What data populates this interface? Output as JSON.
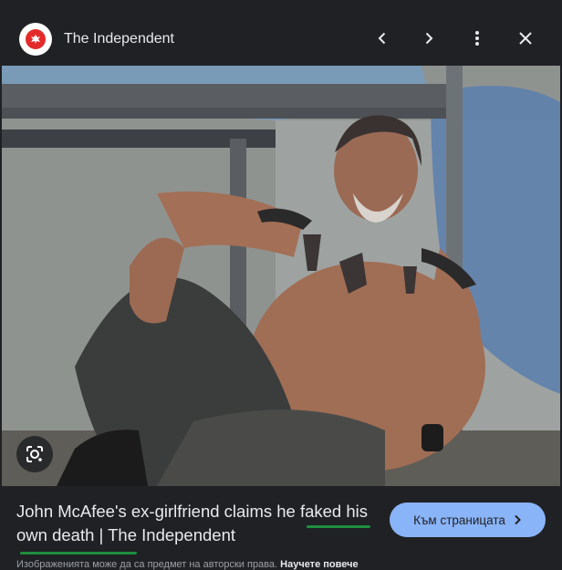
{
  "header": {
    "source_name": "The Independent",
    "icons": [
      "independent-eagle-logo",
      "chevron-left-icon",
      "chevron-right-icon",
      "more-vert-icon",
      "close-icon"
    ]
  },
  "image": {
    "lens_icon": "google-lens-icon"
  },
  "caption": {
    "title": "John McAfee's ex-girlfriend claims he faked his own death | The Independent"
  },
  "visit_button": {
    "label": "Към страницата",
    "icon": "chevron-right-icon"
  },
  "copyright": {
    "text": "Изображенията може да са предмет на авторски права.",
    "learn_more": "Научете повече"
  },
  "colors": {
    "background": "#202124",
    "accent": "#8ab4f8",
    "highlight_underline": "#1e8e3e",
    "logo_red": "#e32b2b"
  }
}
